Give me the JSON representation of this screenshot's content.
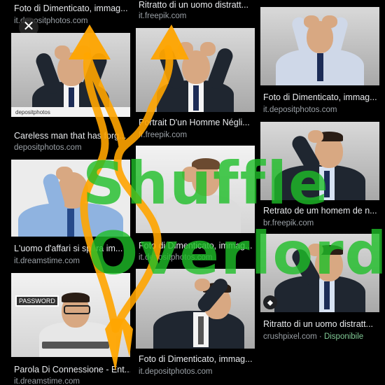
{
  "results": [
    {
      "caption": "Foto di Dimenticato, immag...",
      "source": "it.depositphotos.com"
    },
    {
      "caption": "Ritratto di un uomo distratt...",
      "source": "it.freepik.com"
    },
    {
      "caption": "Careless man that has forg...",
      "source": "depositphotos.com",
      "watermark": "depositphotos"
    },
    {
      "caption": "Portrait D'un Homme Négli...",
      "source": "fr.freepik.com"
    },
    {
      "caption": "Foto di Dimenticato, immag...",
      "source": "it.depositphotos.com"
    },
    {
      "caption": "Retrato de um homem de n...",
      "source": "br.freepik.com"
    },
    {
      "caption": "L'uomo d'affari si spara im...",
      "source": "it.dreamstime.com"
    },
    {
      "caption": "Foto di Dimenticato, immag...",
      "source": "it.depositphotos.com"
    },
    {
      "caption": "Ritratto di un uomo distratt...",
      "source": "crushpixel.com",
      "availability": "Disponibile"
    },
    {
      "caption": "Parola Di Connessione - Ent...",
      "source": "it.dreamstime.com",
      "sign": "PASSWORD"
    },
    {
      "caption": "Foto di Dimenticato, immag...",
      "source": "it.depositphotos.com"
    }
  ],
  "overlay": {
    "line1": "Shuffle",
    "line2": "Overlord",
    "color": "#1ebe28",
    "arrow_color": "#ffa500"
  },
  "icons": {
    "close": "close-icon",
    "tag": "tag-icon"
  }
}
